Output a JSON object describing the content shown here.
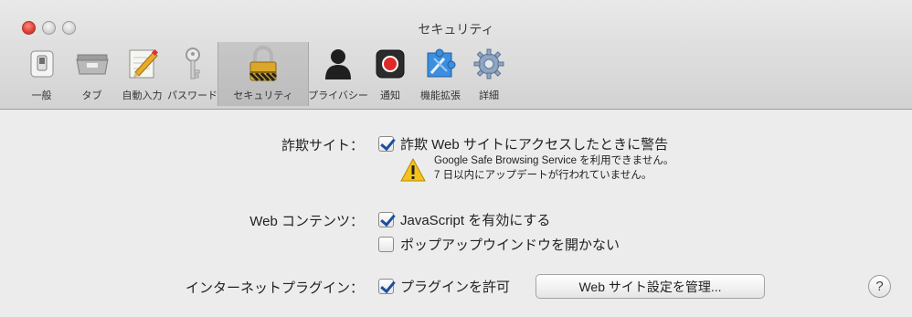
{
  "window": {
    "title": "セキュリティ"
  },
  "toolbar": {
    "items": [
      {
        "label": "一般",
        "icon": "switch-icon"
      },
      {
        "label": "タブ",
        "icon": "tabs-icon"
      },
      {
        "label": "自動入力",
        "icon": "autofill-pencil-icon"
      },
      {
        "label": "パスワード",
        "icon": "key-icon"
      },
      {
        "label": "セキュリティ",
        "icon": "padlock-icon"
      },
      {
        "label": "プライバシー",
        "icon": "person-silhouette-icon"
      },
      {
        "label": "通知",
        "icon": "notification-icon"
      },
      {
        "label": "機能拡張",
        "icon": "puzzle-extension-icon"
      },
      {
        "label": "詳細",
        "icon": "gear-icon"
      }
    ],
    "selected": "セキュリティ"
  },
  "security": {
    "fraud": {
      "label": "詐欺サイト：",
      "option": "詐欺 Web サイトにアクセスしたときに警告",
      "checked": true,
      "warning_line1": "Google Safe Browsing Service を利用できません。",
      "warning_line2": "7 日以内にアップデートが行われていません。"
    },
    "web_content": {
      "label": "Web コンテンツ：",
      "javascript": {
        "label": "JavaScript を有効にする",
        "checked": true
      },
      "popups": {
        "label": "ポップアップウインドウを開かない",
        "checked": false
      }
    },
    "plugins": {
      "label": "インターネットプラグイン：",
      "allow": {
        "label": "プラグインを許可",
        "checked": true
      },
      "manage_button": "Web サイト設定を管理..."
    },
    "help": "?"
  },
  "colors": {
    "close": "#e0443a",
    "check": "#1c4f9c",
    "warning": "#f4c21b"
  }
}
